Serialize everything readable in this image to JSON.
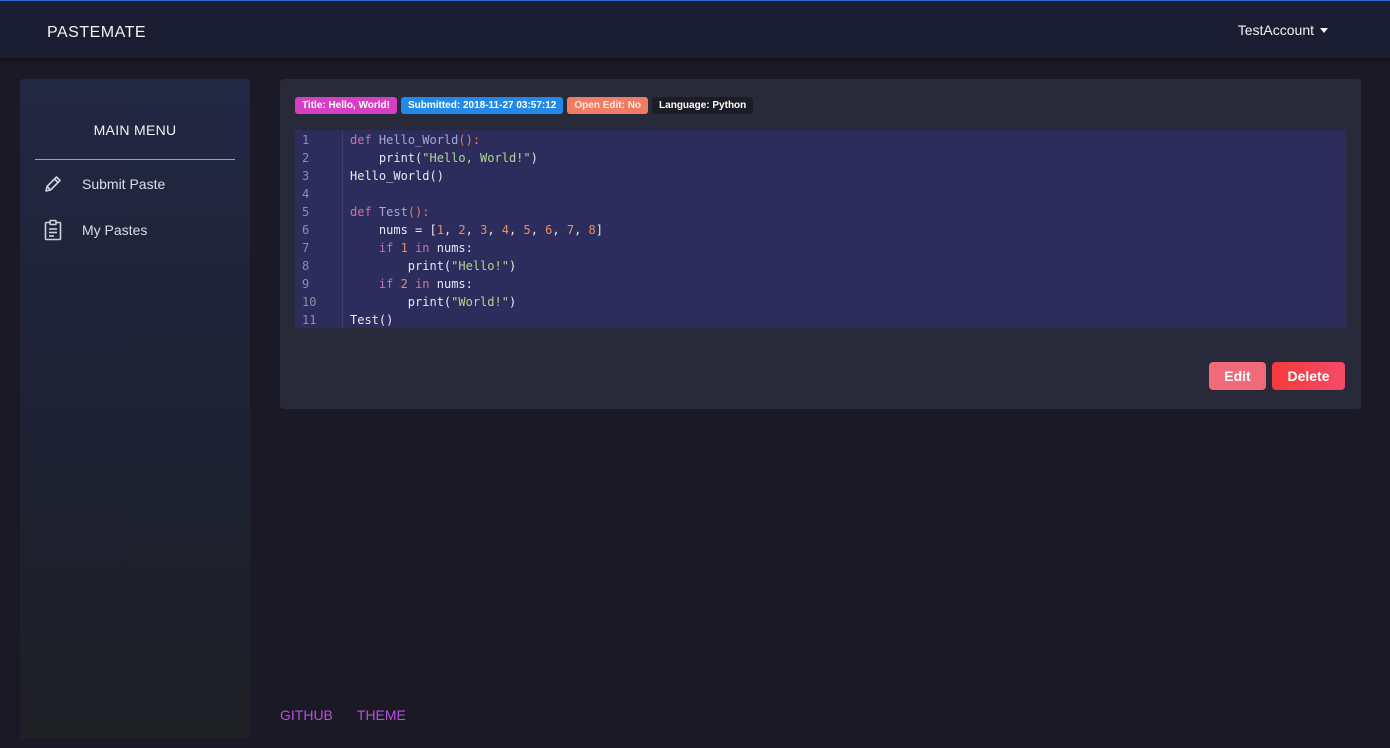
{
  "navbar": {
    "brand": "PASTEMATE",
    "account": "TestAccount"
  },
  "sidebar": {
    "title": "MAIN MENU",
    "items": [
      {
        "label": "Submit Paste",
        "icon": "pencil-icon"
      },
      {
        "label": "My Pastes",
        "icon": "clipboard-icon"
      }
    ]
  },
  "paste": {
    "badges": {
      "title": "Title: Hello, World!",
      "submitted": "Submitted: 2018-11-27 03:57:12",
      "open_edit": "Open Edit: No",
      "language": "Language: Python"
    },
    "line_numbers": [
      "1",
      "2",
      "3",
      "4",
      "5",
      "6",
      "7",
      "8",
      "9",
      "10",
      "11"
    ],
    "code_lines": [
      "def Hello_World():",
      "    print(\"Hello, World!\")",
      "Hello_World()",
      "",
      "def Test():",
      "    nums = [1, 2, 3, 4, 5, 6, 7, 8]",
      "    if 1 in nums:",
      "        print(\"Hello!\")",
      "    if 2 in nums:",
      "        print(\"World!\")",
      "Test()"
    ],
    "buttons": {
      "edit": "Edit",
      "delete": "Delete"
    }
  },
  "footer": {
    "links": [
      "GITHUB",
      "THEME"
    ]
  },
  "colors": {
    "background": "#1a1925",
    "navbar": "#1b1e33",
    "card": "#282a3a",
    "code_background": "#2c2d5c",
    "badge_title": "#d63ec4",
    "badge_submitted": "#2389e9",
    "badge_open_edit": "#f07c64",
    "badge_language": "#1c1d24",
    "edit_button": "#f06a7a",
    "delete_button": "#f43a3a",
    "footer_link": "#b84ee0"
  }
}
